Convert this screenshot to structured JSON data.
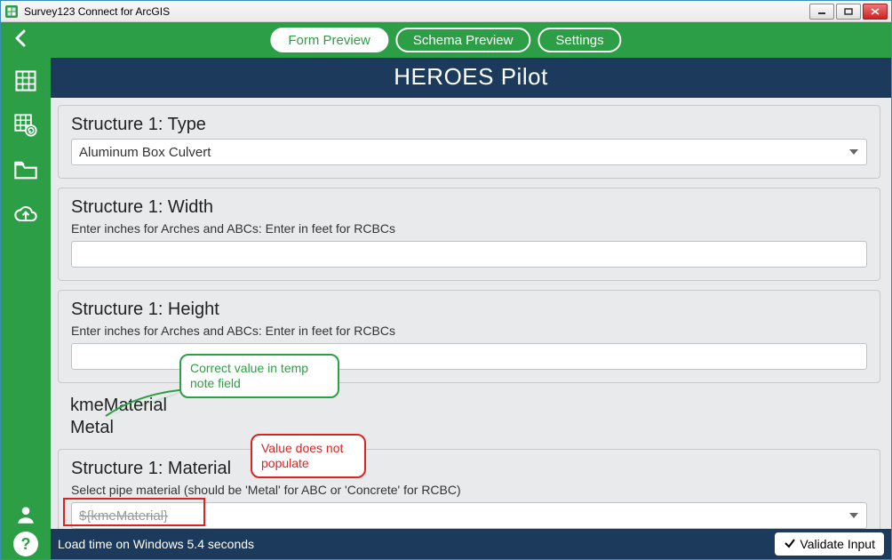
{
  "window": {
    "title": "Survey123 Connect for ArcGIS"
  },
  "tabs": {
    "form": "Form Preview",
    "schema": "Schema Preview",
    "settings": "Settings"
  },
  "form": {
    "title": "HEROES Pilot",
    "q_type_label": "Structure 1: Type",
    "q_type_value": "Aluminum Box Culvert",
    "q_width_label": "Structure 1: Width",
    "q_width_hint": "Enter inches for Arches and ABCs: Enter in feet for RCBCs",
    "q_height_label": "Structure 1: Height",
    "q_height_hint": "Enter inches for Arches and ABCs: Enter in feet for RCBCs",
    "note_label": "kmeMaterial",
    "note_value": "Metal",
    "q_material_label": "Structure 1: Material",
    "q_material_hint": "Select pipe material (should be 'Metal' for ABC or 'Concrete' for RCBC)",
    "q_material_placeholder": "${kmeMaterial}"
  },
  "annotations": {
    "correct": "Correct value in temp note field",
    "notpop": "Value does not populate"
  },
  "footer": {
    "loadtime": "Load time on Windows 5.4 seconds",
    "validate": "Validate Input"
  }
}
